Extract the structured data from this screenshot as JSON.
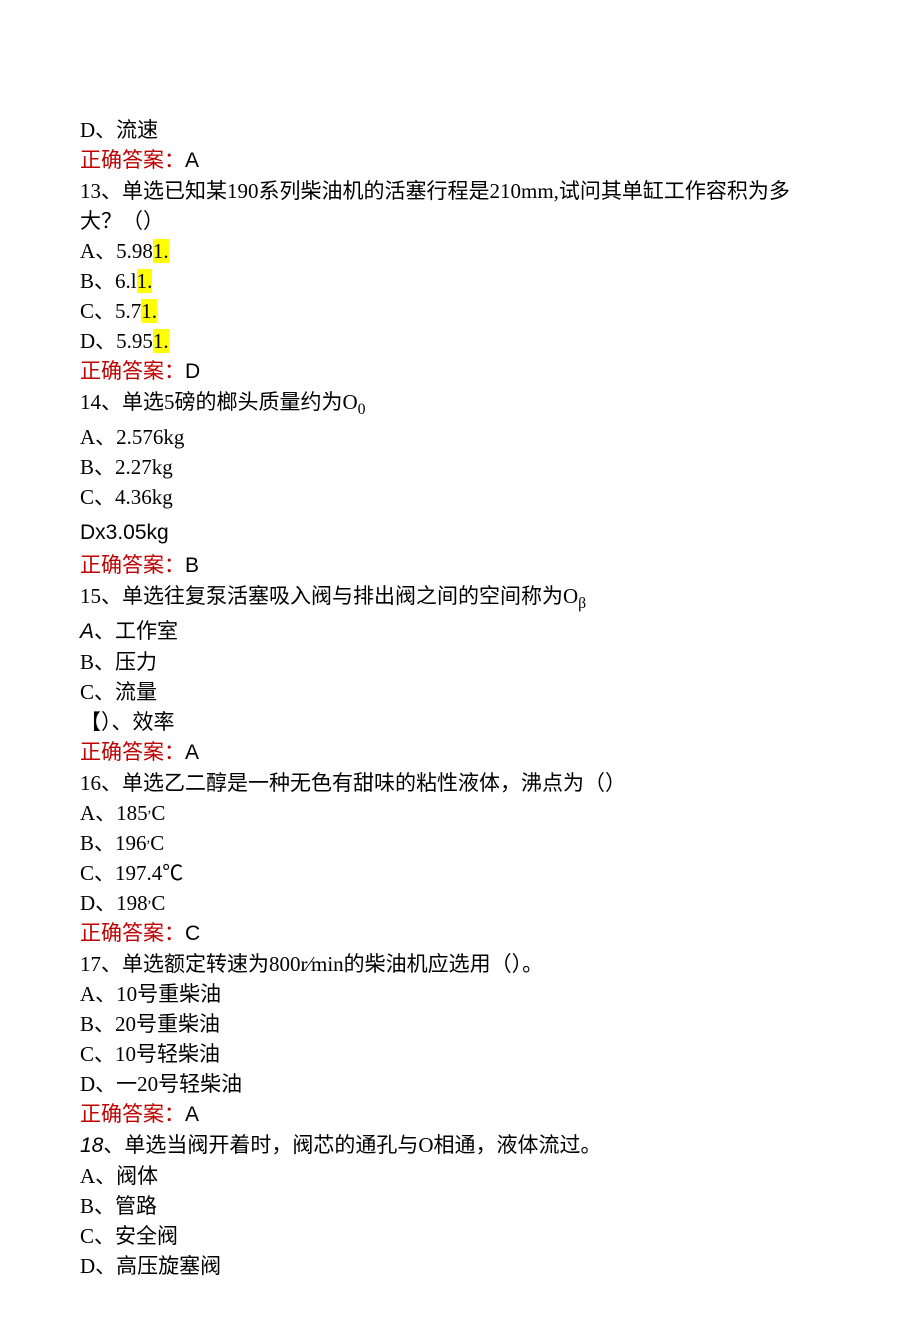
{
  "q12": {
    "optD": "D、流速",
    "answerLabel": "正确答案：",
    "answerValue": "A"
  },
  "q13": {
    "stem1": "13、单选已知某190系列柴油机的活塞行程是210mm,试问其单缸工作容积为多",
    "stem2": "大？（）",
    "optA_prefix": "A、5.98",
    "optA_hl": "1.",
    "optB_prefix": "B、6.l",
    "optB_hl": "1.",
    "optC_prefix": "C、5.7",
    "optC_hl": "1.",
    "optD_prefix": "D、5.95",
    "optD_hl": "1.",
    "answerLabel": "正确答案：",
    "answerValue": "D"
  },
  "q14": {
    "stem_prefix": "14、单选5磅的榔头质量约为O",
    "stem_sub": "0",
    "optA": "A、2.576kg",
    "optB": "B、2.27kg",
    "optC": "C、4.36kg",
    "optD": "Dx3.05kg",
    "answerLabel": "正确答案：",
    "answerValue": "B"
  },
  "q15": {
    "stem_prefix": "15、单选往复泵活塞吸入阀与排出阀之间的空间称为O",
    "stem_sub": "β",
    "optA_prefix": "A",
    "optA_suffix": "、工作室",
    "optB": "B、压力",
    "optC": "C、流量",
    "optD": "【）、效率",
    "answerLabel": "正确答案：",
    "answerValue": "A"
  },
  "q16": {
    "stem": "16、单选乙二醇是一种无色有甜味的粘性液体，沸点为（）",
    "optA_prefix": "A、185",
    "optA_sup": ",",
    "optA_suffix": "C",
    "optB_prefix": "B、196",
    "optB_sup": ",",
    "optB_suffix": "C",
    "optC": "C、197.4℃",
    "optD_prefix": "D、198",
    "optD_sup": ",",
    "optD_suffix": "C",
    "answerLabel": "正确答案：",
    "answerValue": "C"
  },
  "q17": {
    "stem": "17、单选额定转速为800r⁄min的柴油机应选用（）。",
    "optA": "A、10号重柴油",
    "optB": "B、20号重柴油",
    "optC": "C、10号轻柴油",
    "optD": "D、一20号轻柴油",
    "answerLabel": "正确答案：",
    "answerValue": "A"
  },
  "q18": {
    "stem_prefix": "18",
    "stem_suffix": "、单选当阀开着时，阀芯的通孔与O相通，液体流过。",
    "optA": "A、阀体",
    "optB": "B、管路",
    "optC": "C、安全阀",
    "optD": "D、高压旋塞阀"
  }
}
